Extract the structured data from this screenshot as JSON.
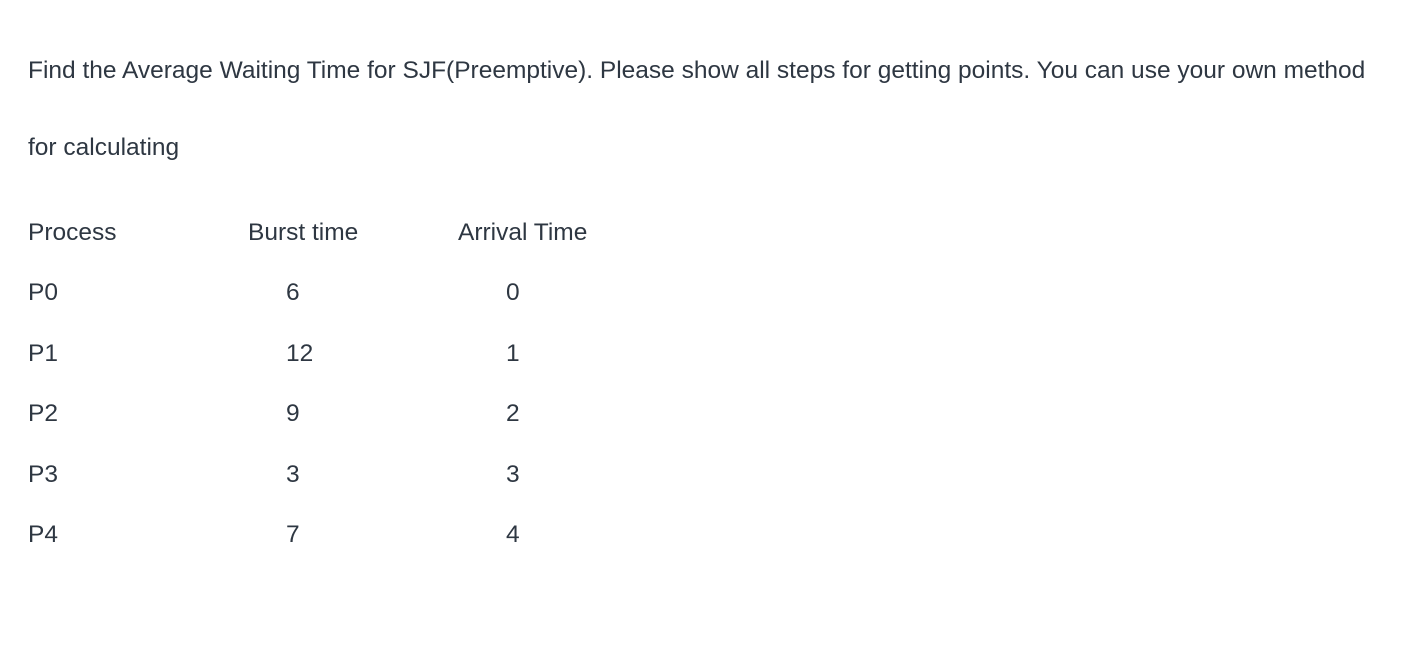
{
  "question": {
    "para1": "Find the Average Waiting Time for SJF(Preemptive).  Please show all steps for getting points. You can use your own method",
    "para2": "for calculating"
  },
  "table": {
    "headers": {
      "process": "Process",
      "burst": "Burst time",
      "arrival": "Arrival Time"
    },
    "rows": [
      {
        "process": "P0",
        "burst": "6",
        "arrival": "0"
      },
      {
        "process": "P1",
        "burst": "12",
        "arrival": "1"
      },
      {
        "process": "P2",
        "burst": "9",
        "arrival": "2"
      },
      {
        "process": "P3",
        "burst": "3",
        "arrival": "3"
      },
      {
        "process": "P4",
        "burst": "7",
        "arrival": "4"
      }
    ]
  }
}
